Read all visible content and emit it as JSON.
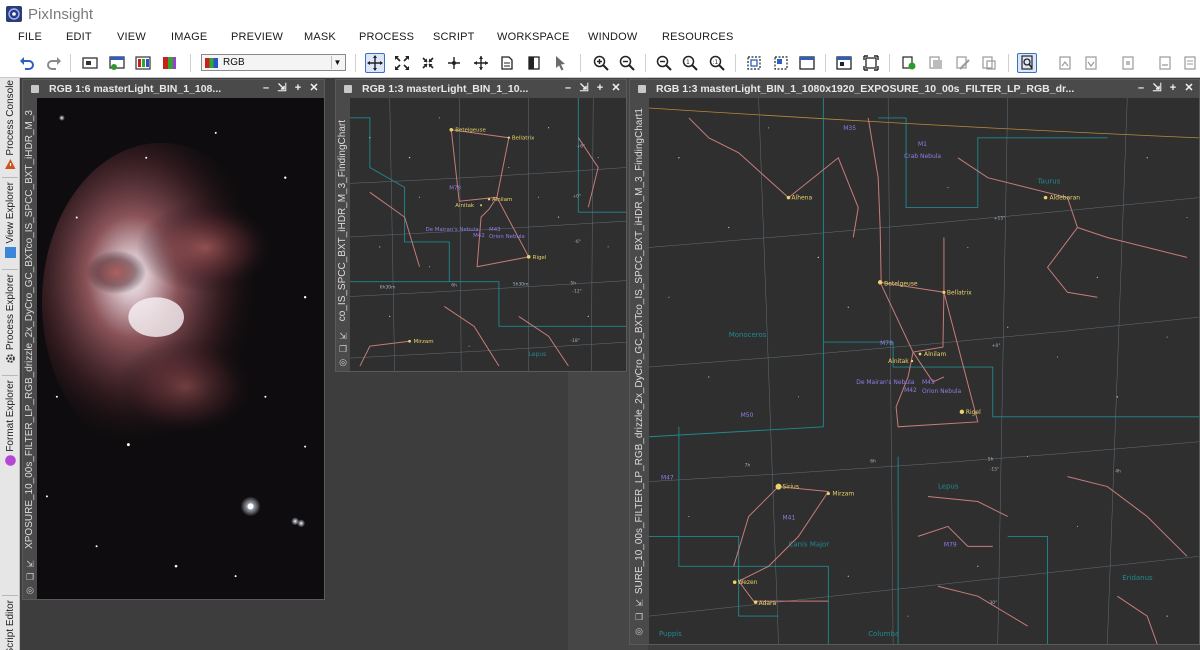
{
  "app": {
    "title": "PixInsight",
    "accent_color": "#3d6fc7"
  },
  "menubar": {
    "items": [
      "FILE",
      "EDIT",
      "VIEW",
      "IMAGE",
      "PREVIEW",
      "MASK",
      "PROCESS",
      "SCRIPT",
      "WORKSPACE",
      "WINDOW",
      "RESOURCES"
    ]
  },
  "toolbar": {
    "rgb_select_value": "RGB",
    "icons": [
      "undo-icon",
      "redo-icon",
      "image-new-icon",
      "image-info-icon",
      "channels-icon",
      "rgb-icon",
      "pan-icon",
      "fit-view-icon",
      "fit-window-icon",
      "zoom-move-icon",
      "center-icon",
      "readout-icon",
      "mask-icon",
      "pointer-icon",
      "zoom-in-icon",
      "zoom-out-icon",
      "zoom-in-2-icon",
      "zoom-fit-icon",
      "zoom-1-icon",
      "new-preview-icon",
      "select-preview-icon",
      "edit-preview-icon",
      "transparency-icon",
      "fullscreen-icon",
      "mask-show-icon",
      "mask-new-icon",
      "mask-invert-icon",
      "mask-remove-icon",
      "stf-active-icon",
      "stf-icon-1",
      "stf-icon-2",
      "stf-icon-3",
      "stf-icon-4",
      "stf-icon-5"
    ]
  },
  "sidebar": {
    "tabs": [
      "Process Console",
      "View Explorer",
      "Process Explorer",
      "Format Explorer",
      "Script Editor"
    ]
  },
  "windows": {
    "nebula": {
      "title": "RGB 1:6 masterLight_BIN_1_108...",
      "side_label": "XPOSURE_10_00s_FILTER_LP_RGB_drizzle_2x_DyCro_GC_BXTco_IS_SPCC_BXT_iHDR_M_3"
    },
    "chart_small": {
      "title": "RGB 1:3 masterLight_BIN_1_10...",
      "side_label": "co_IS_SPCC_BXT_iHDR_M_3_FindingChart",
      "labels": {
        "betelgeuse": "Betelgeuse",
        "bellatrix": "Bellatrix",
        "m78": "M78",
        "alnitak": "Alnitak",
        "alnilam": "Alnilam",
        "de_mairan": "De Mairan's Nebula",
        "m43": "M43",
        "m42": "M42",
        "orion_nebula": "Orion Nebula",
        "rigel": "Rigel",
        "mirzam": "Mirzam",
        "lepus": "Lepus",
        "ra1": "6h30m",
        "ra2": "6h",
        "ra3": "5h30m",
        "ra4": "5h",
        "dec1": "+6°",
        "dec2": "+0°",
        "dec3": "-6°",
        "dec4": "-12°",
        "dec5": "-18°"
      }
    },
    "chart_large": {
      "title": "RGB 1:3 masterLight_BIN_1_1080x1920_EXPOSURE_10_00s_FILTER_LP_RGB_dr...",
      "side_label": "SURE_10_00s_FILTER_LP_RGB_drizzle_2x_DyCro_GC_BXTco_IS_SPCC_BXT_iHDR_M_3_FindingChart1",
      "labels": {
        "m35": "M35",
        "m1": "M1",
        "crab": "Crab Nebula",
        "taurus": "Taurus",
        "aldebaran": "Aldebaran",
        "alhena": "Alhena",
        "plus15": "+15°",
        "betelgeuse": "Betelgeuse",
        "bellatrix": "Bellatrix",
        "monoceros": "Monoceros",
        "m78": "M78",
        "alnitak": "Alnitak",
        "alnilam": "Alnilam",
        "plus0": "+0°",
        "de_mairan": "De Mairan's Nebula",
        "m43": "M43",
        "m42": "M42",
        "orion_nebula": "Orion Nebula",
        "rigel": "Rigel",
        "m50": "M50",
        "m47": "M47",
        "sirius": "Sirius",
        "mirzam": "Mirzam",
        "lepus": "Lepus",
        "minus15": "-15°",
        "m41": "M41",
        "canis_major": "Canis Major",
        "m79": "M79",
        "wezen": "Wezen",
        "adara": "Adara",
        "minus30": "-30°",
        "eridanus": "Eridanus",
        "puppis": "Puppis",
        "columba": "Columba",
        "ra7h": "7h",
        "ra6h": "6h",
        "ra5h": "5h",
        "ra4h": "4h"
      }
    }
  }
}
